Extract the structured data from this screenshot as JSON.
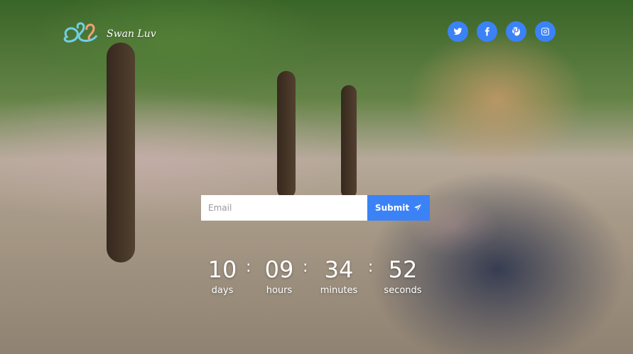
{
  "brand": {
    "name": "Swan Luv"
  },
  "social": [
    {
      "icon": "twitter-icon"
    },
    {
      "icon": "facebook-icon"
    },
    {
      "icon": "pinterest-icon"
    },
    {
      "icon": "instagram-icon"
    }
  ],
  "subscribe": {
    "email_placeholder": "Email",
    "email_value": "",
    "submit_label": "Submit"
  },
  "countdown": {
    "days": {
      "value": "10",
      "label": "days"
    },
    "hours": {
      "value": "09",
      "label": "hours"
    },
    "minutes": {
      "value": "34",
      "label": "minutes"
    },
    "seconds": {
      "value": "52",
      "label": "seconds"
    },
    "separator": ":"
  },
  "colors": {
    "accent": "#3b82f6",
    "text": "#ffffff"
  }
}
